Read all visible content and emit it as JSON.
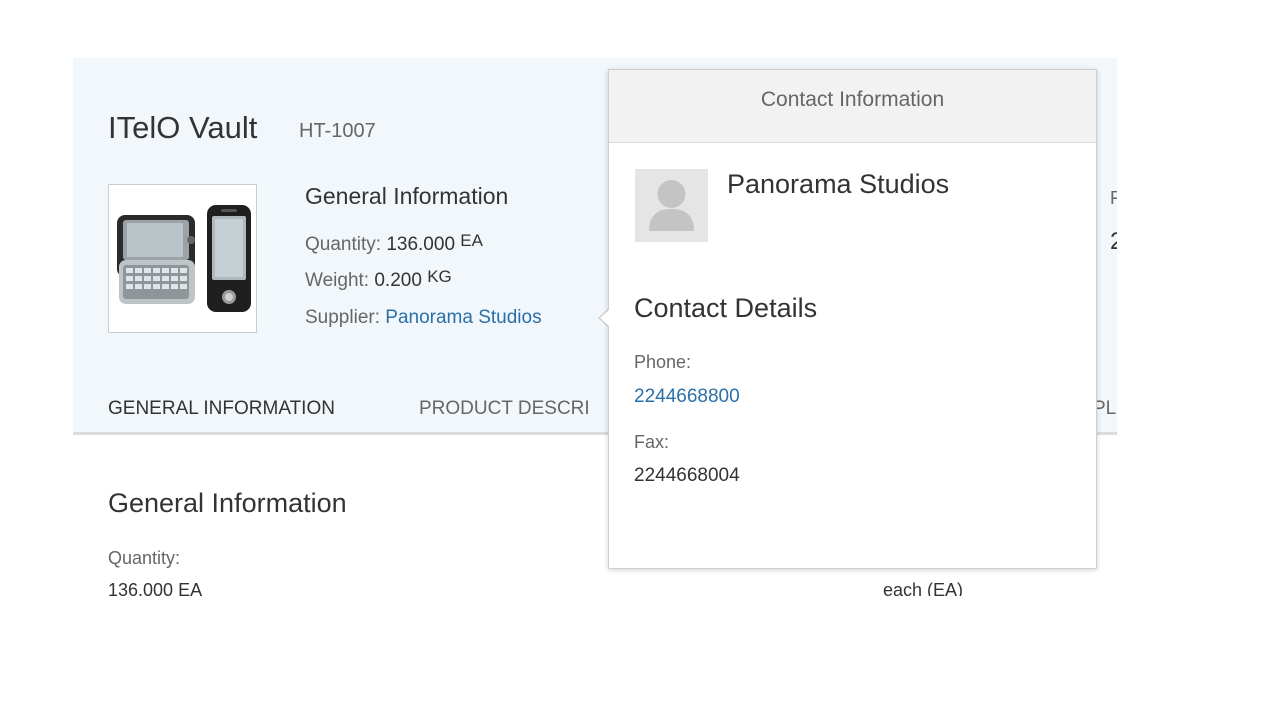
{
  "header": {
    "title": "ITelO Vault",
    "subtitle": "HT-1007",
    "image_icon": "phone-product-image",
    "attributes": {
      "heading": "General Information",
      "quantity_label": "Quantity:",
      "quantity_value": "136.000",
      "quantity_unit": "EA",
      "weight_label": "Weight:",
      "weight_value": "0.200",
      "weight_unit": "KG",
      "supplier_label": "Supplier:",
      "supplier_value": "Panorama Studios"
    },
    "right_peek_label": "F",
    "right_peek_value": "2"
  },
  "tabs": [
    {
      "label": "GENERAL INFORMATION",
      "selected": true
    },
    {
      "label": "PRODUCT DESCRI",
      "selected": false
    },
    {
      "label": "PL",
      "selected": false
    }
  ],
  "section": {
    "title": "General Information",
    "quantity_label": "Quantity:",
    "quantity_value": "136.000 EA",
    "unit_value": "each (EA)"
  },
  "popover": {
    "title": "Contact Information",
    "avatar_icon": "person-icon",
    "company": "Panorama Studios",
    "details_heading": "Contact Details",
    "phone_label": "Phone:",
    "phone_value": "2244668800",
    "fax_label": "Fax:",
    "fax_value": "2244668004"
  },
  "colors": {
    "header_bg": "#f2f7fb",
    "link": "#2a6fa8",
    "popover_header_bg": "#f2f2f2"
  }
}
